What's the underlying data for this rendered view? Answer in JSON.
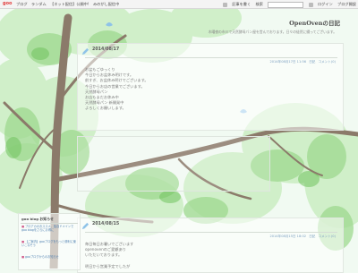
{
  "toolbar": {
    "logo": "goo",
    "nav": [
      "ブログ",
      "ランダム",
      "【ネット配信】公開中!",
      "みのがし配信中"
    ],
    "right": [
      "記事を書く",
      "検索",
      "ログイン",
      "ブログ開設"
    ]
  },
  "header": {
    "title": "OpenOvenの日記",
    "description": "木曜夜の市川で天然酵母パン屋を営んでおります。日々の徒然に綴ってございます。"
  },
  "posts": [
    {
      "date": "2014/08/17",
      "meta": [
        "2014年08月17日 11:56",
        "日記",
        "コメント(0)"
      ],
      "lines": [
        "お盆もごゆっくり",
        "今日からお盆休み明けです。",
        "前すぎ、お盆休み明けでございます。",
        "今日からお店の営業でございます。",
        "天然酵母パン",
        "お店もまだお休み中",
        "天然酵母パン 新開発中",
        "よろしくお願いします。"
      ]
    },
    {
      "date": "2014/08/15",
      "meta": [
        "2014年08月15日 18:02",
        "日記",
        "コメント(0)"
      ],
      "lines": [
        "毎日毎日お暑いでございます",
        "openovenのご愛顧あり",
        "いただいております。",
        "",
        "明日から営業予定でしたが"
      ]
    }
  ],
  "sidebar": {
    "title": "goo blog お知らせ",
    "items": [
      "プロアカのおススメ、独自ドメインでgoo blogをさらにお得に",
      "【ご案内】gooブログをもっと便利に使いこなそう",
      "gooブログからのお知らせ"
    ]
  },
  "colors": {
    "leaf_light": "#cdeec5",
    "leaf_mid": "#9ed98f",
    "leaf_dark": "#6fc25c",
    "trunk": "#8b7a6a",
    "bird": "#8fc3e8"
  },
  "icons": [
    "pencil-icon",
    "bird-icon",
    "search-icon"
  ]
}
